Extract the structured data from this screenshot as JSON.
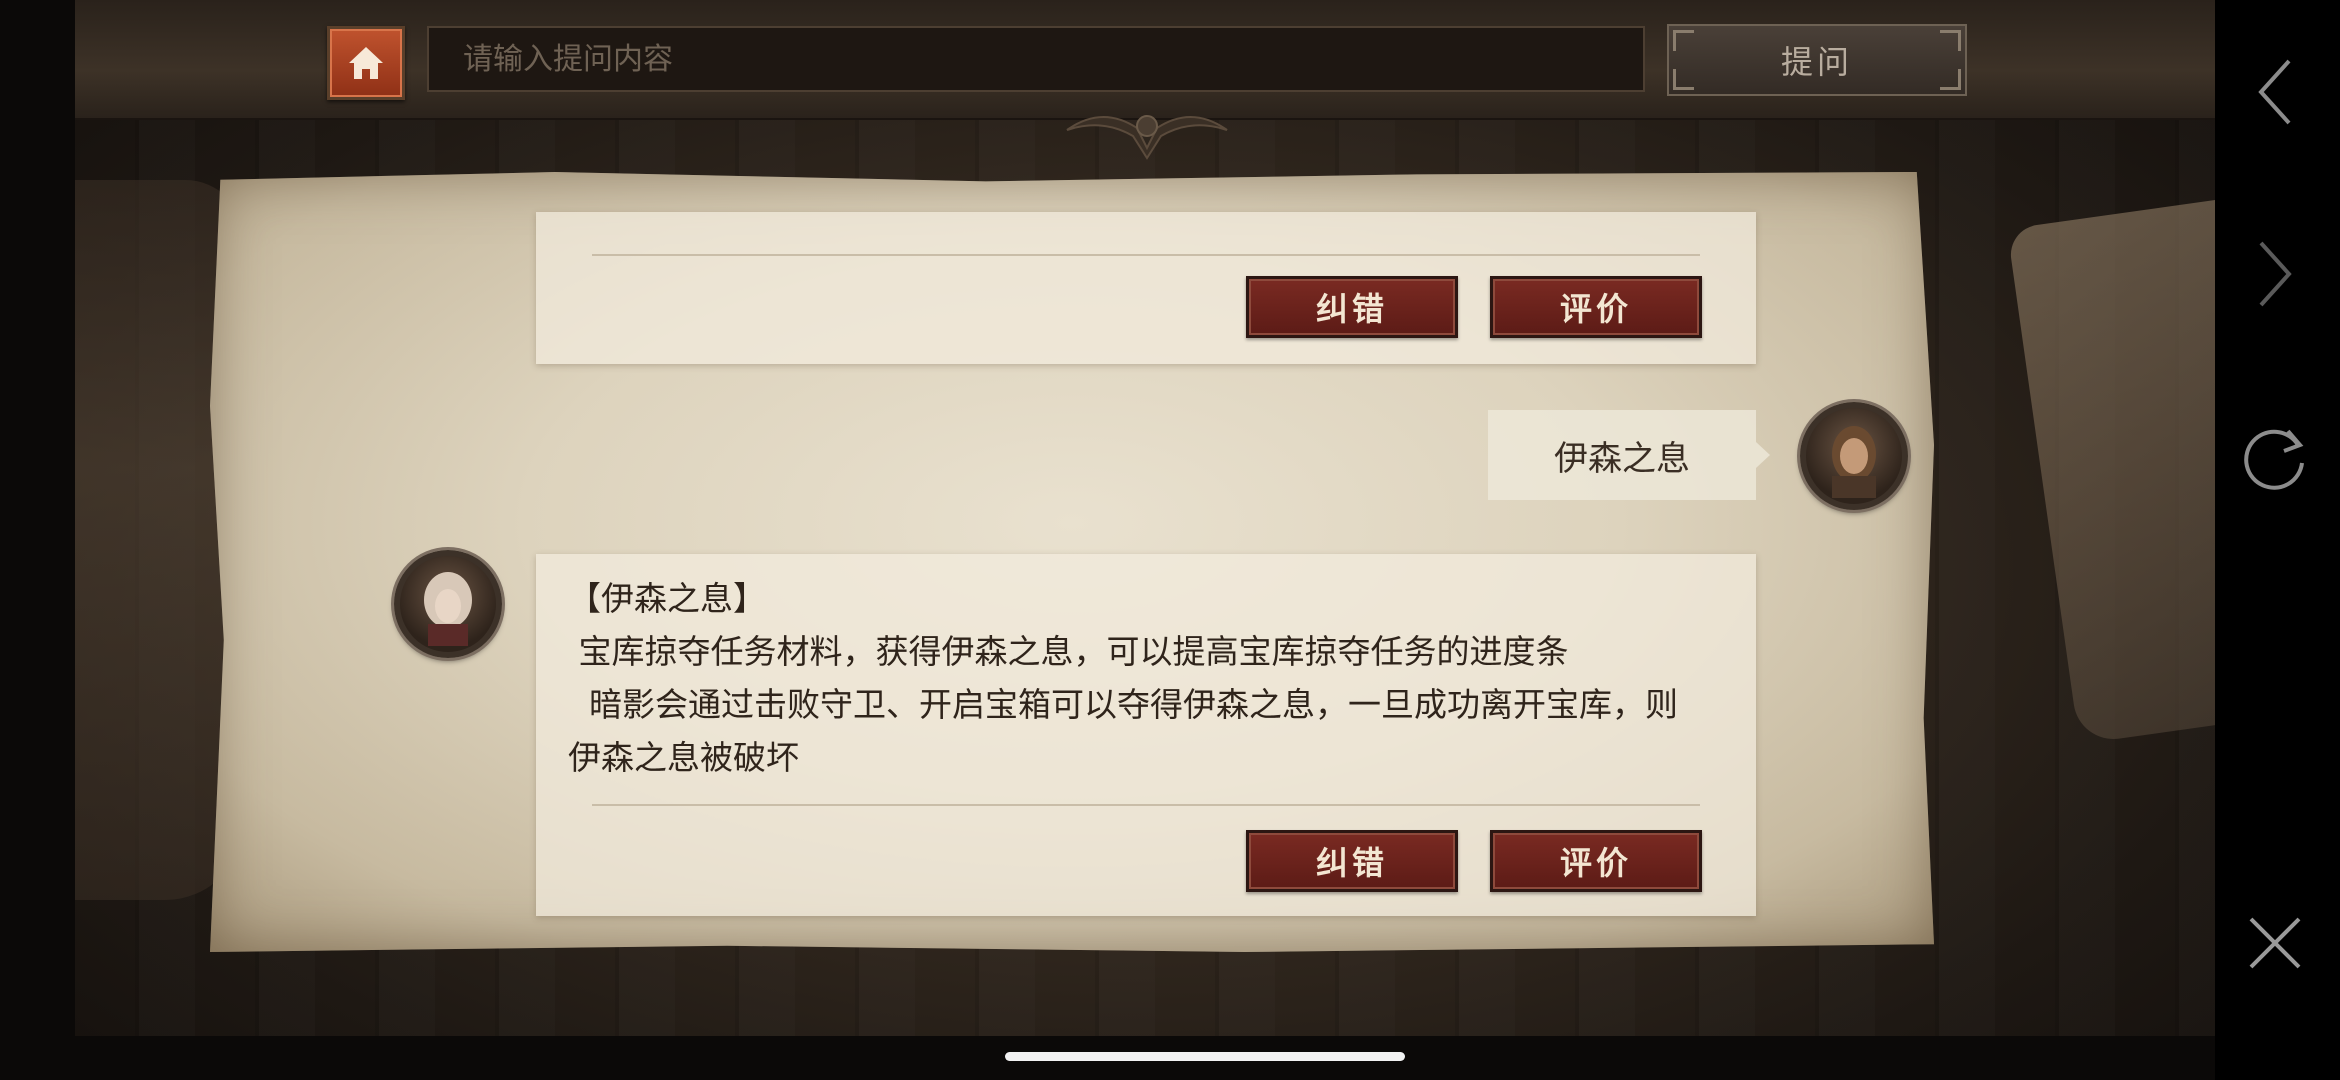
{
  "header": {
    "search_placeholder": "请输入提问内容",
    "search_value": "",
    "ask_label": "提问"
  },
  "chat": {
    "first_card": {
      "correct_label": "纠错",
      "rate_label": "评价"
    },
    "user_message": "伊森之息",
    "answer": {
      "title": "【伊森之息】",
      "line1": " 宝库掠夺任务材料，获得伊森之息，可以提高宝库掠夺任务的进度条",
      "line2": "  暗影会通过击败守卫、开启宝箱可以夺得伊森之息，一旦成功离开宝库，则伊森之息被破坏",
      "correct_label": "纠错",
      "rate_label": "评价"
    }
  },
  "colors": {
    "accent_red": "#6b221c",
    "parchment": "#e3dac6",
    "home_orange": "#b0462a"
  },
  "icons": [
    "home-icon",
    "back-chevron-icon",
    "forward-chevron-icon",
    "refresh-icon",
    "close-icon"
  ]
}
